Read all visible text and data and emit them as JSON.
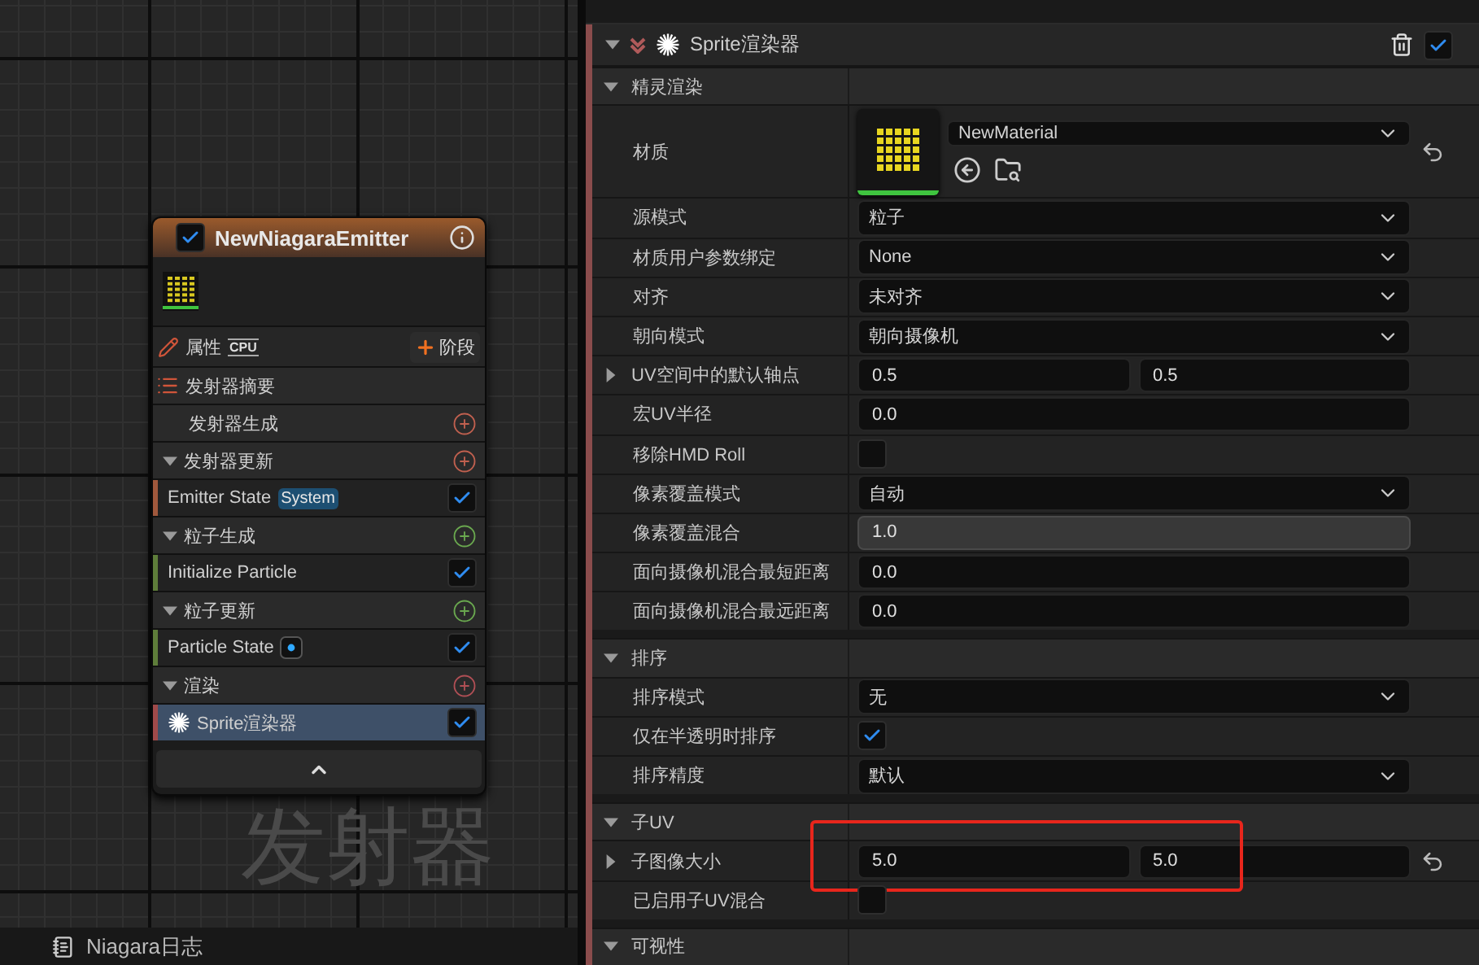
{
  "canvas": {
    "label": "发射器"
  },
  "emitter_node": {
    "title": "NewNiagaraEmitter",
    "enabled": true,
    "properties": {
      "label": "属性",
      "sim_target": "CPU",
      "add_stage": "阶段"
    },
    "items": [
      {
        "kind": "summary",
        "label": "发射器摘要"
      },
      {
        "kind": "stage_plain",
        "label": "发射器生成",
        "color": "#c0604f"
      },
      {
        "kind": "stage",
        "label": "发射器更新",
        "color": "#c0604f"
      },
      {
        "kind": "module",
        "label": "Emitter State",
        "badge": "System",
        "dot_badge": false,
        "checked": true,
        "color": "#a0583c"
      },
      {
        "kind": "stage",
        "label": "粒子生成",
        "color": "#6aa84f"
      },
      {
        "kind": "module",
        "label": "Initialize Particle",
        "dot_badge": false,
        "checked": true,
        "color": "#5e7d3a"
      },
      {
        "kind": "stage",
        "label": "粒子更新",
        "color": "#6aa84f"
      },
      {
        "kind": "module",
        "label": "Particle State",
        "dot_badge": true,
        "checked": true,
        "color": "#5e7d3a"
      },
      {
        "kind": "stage",
        "label": "渲染",
        "color": "#b04f55"
      },
      {
        "kind": "renderer",
        "label": "Sprite渲染器",
        "checked": true,
        "selected": true,
        "color": "#a04a4a"
      }
    ]
  },
  "bottom_bar": {
    "tab": "Niagara日志"
  },
  "details": {
    "title": "Sprite渲染器",
    "enabled": true,
    "sections": [
      {
        "title": "精灵渲染",
        "expanded": true,
        "rows": [
          {
            "kind": "material",
            "label": "材质",
            "value": "NewMaterial",
            "resettable": true,
            "annotated": false
          },
          {
            "kind": "dropdown",
            "label": "源模式",
            "value": "粒子",
            "resettable": false,
            "annotated": false
          },
          {
            "kind": "dropdown",
            "label": "材质用户参数绑定",
            "value": "None",
            "resettable": false,
            "annotated": false
          },
          {
            "kind": "dropdown",
            "label": "对齐",
            "value": "未对齐",
            "resettable": false,
            "annotated": false
          },
          {
            "kind": "dropdown",
            "label": "朝向模式",
            "value": "朝向摄像机",
            "resettable": false,
            "annotated": false
          },
          {
            "kind": "vector2",
            "label": "UV空间中的默认轴点",
            "values": [
              "0.5",
              "0.5"
            ],
            "expanded": false,
            "resettable": false,
            "annotated": false
          },
          {
            "kind": "number",
            "label": "宏UV半径",
            "value": "0.0",
            "resettable": false,
            "annotated": false
          },
          {
            "kind": "checkbox",
            "label": "移除HMD Roll",
            "checked": false,
            "resettable": false,
            "annotated": false
          },
          {
            "kind": "dropdown",
            "label": "像素覆盖模式",
            "value": "自动",
            "resettable": false,
            "annotated": false
          },
          {
            "kind": "spinbox",
            "label": "像素覆盖混合",
            "value": "1.0",
            "resettable": false,
            "annotated": false
          },
          {
            "kind": "number",
            "label": "面向摄像机混合最短距离",
            "value": "0.0",
            "resettable": false,
            "annotated": false
          },
          {
            "kind": "number",
            "label": "面向摄像机混合最远距离",
            "value": "0.0",
            "resettable": false,
            "annotated": false
          }
        ]
      },
      {
        "title": "排序",
        "expanded": true,
        "rows": [
          {
            "kind": "dropdown",
            "label": "排序模式",
            "value": "无",
            "resettable": false,
            "annotated": false
          },
          {
            "kind": "checkbox",
            "label": "仅在半透明时排序",
            "checked": true,
            "resettable": false,
            "annotated": false
          },
          {
            "kind": "dropdown",
            "label": "排序精度",
            "value": "默认",
            "resettable": false,
            "annotated": false
          }
        ]
      },
      {
        "title": "子UV",
        "expanded": true,
        "rows": [
          {
            "kind": "vector2",
            "label": "子图像大小",
            "values": [
              "5.0",
              "5.0"
            ],
            "expanded": false,
            "resettable": true,
            "annotated": true
          },
          {
            "kind": "checkbox",
            "label": "已启用子UV混合",
            "checked": false,
            "resettable": false,
            "annotated": false
          }
        ]
      },
      {
        "title": "可视性",
        "expanded": true
      }
    ]
  }
}
